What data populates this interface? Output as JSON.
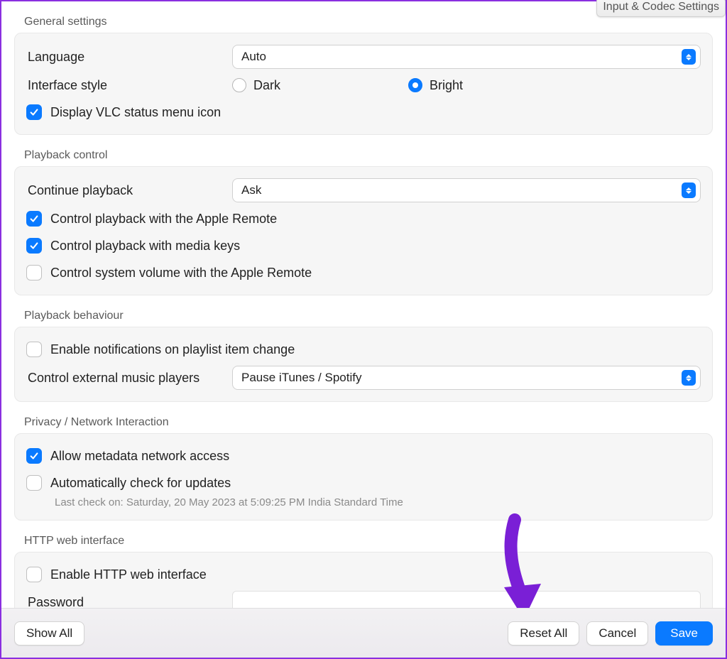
{
  "tab_remnant": "Input & Codec Settings",
  "general": {
    "title": "General settings",
    "language_label": "Language",
    "language_value": "Auto",
    "interface_label": "Interface style",
    "interface_options": {
      "dark": "Dark",
      "bright": "Bright"
    },
    "interface_selected": "bright",
    "status_menu_label": "Display VLC status menu icon",
    "status_menu_checked": true
  },
  "playback_control": {
    "title": "Playback control",
    "continue_label": "Continue playback",
    "continue_value": "Ask",
    "apple_remote_label": "Control playback with the Apple Remote",
    "apple_remote_checked": true,
    "media_keys_label": "Control playback with media keys",
    "media_keys_checked": true,
    "system_volume_label": "Control system volume with the Apple Remote",
    "system_volume_checked": false
  },
  "playback_behaviour": {
    "title": "Playback behaviour",
    "notifications_label": "Enable notifications on playlist item change",
    "notifications_checked": false,
    "external_players_label": "Control external music players",
    "external_players_value": "Pause iTunes / Spotify"
  },
  "privacy": {
    "title": "Privacy / Network Interaction",
    "metadata_label": "Allow metadata network access",
    "metadata_checked": true,
    "updates_label": "Automatically check for updates",
    "updates_checked": false,
    "last_check_text": "Last check on: Saturday, 20 May 2023 at 5:09:25 PM India Standard Time"
  },
  "http": {
    "title": "HTTP web interface",
    "enable_label": "Enable HTTP web interface",
    "enable_checked": false,
    "password_label": "Password",
    "password_value": ""
  },
  "footer": {
    "show_all": "Show All",
    "reset_all": "Reset All",
    "cancel": "Cancel",
    "save": "Save"
  }
}
